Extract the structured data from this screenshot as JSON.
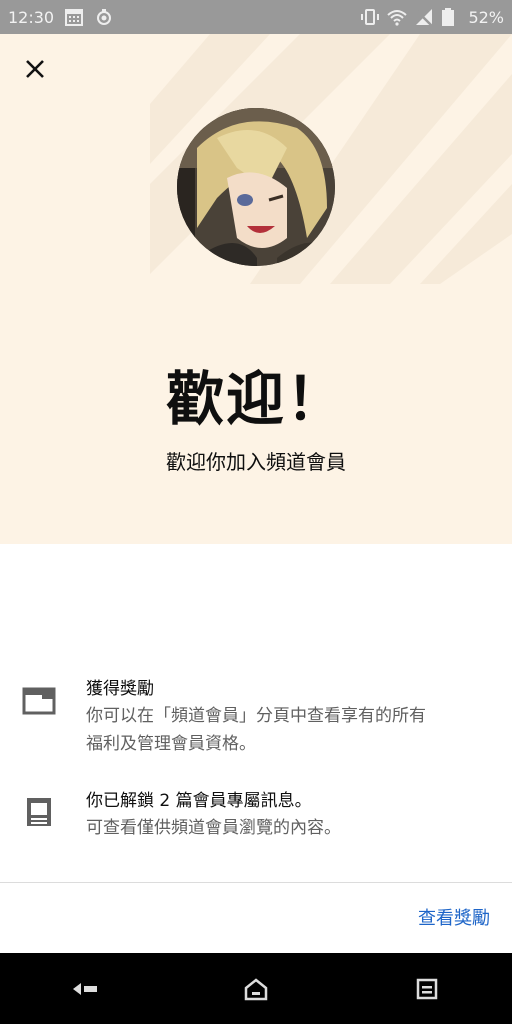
{
  "status_bar": {
    "time": "12:30",
    "battery": "52%",
    "icons": [
      "calendar-icon",
      "notification-icon",
      "vibrate-icon",
      "wifi-icon",
      "no-signal-icon",
      "battery-icon"
    ]
  },
  "hero": {
    "close_icon": "close-icon",
    "title": "歡迎！",
    "subtitle": "歡迎你加入頻道會員",
    "background_color": "#fdf3e5"
  },
  "benefits": [
    {
      "icon": "window-icon",
      "title": "獲得獎勵",
      "desc_line1": "你可以在「頻道會員」分頁中查看享有的所有",
      "desc_line2": "福利及管理會員資格。"
    },
    {
      "icon": "post-icon",
      "title": "你已解鎖 2 篇會員專屬訊息。",
      "desc_line1": "可查看僅供頻道會員瀏覽的內容。"
    }
  ],
  "action": {
    "view_rewards_label": "查看獎勵",
    "accent_color": "#1e65c8"
  },
  "nav_bar": {
    "icons": [
      "back-icon",
      "home-icon",
      "recents-icon"
    ]
  }
}
